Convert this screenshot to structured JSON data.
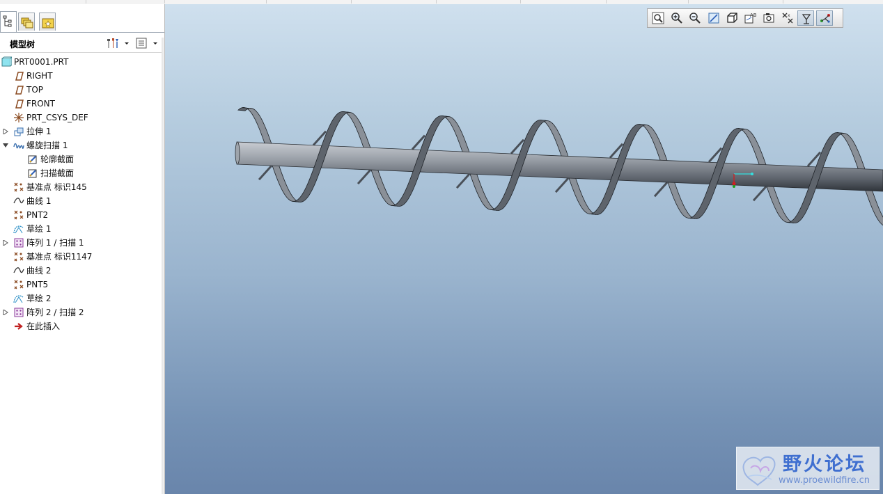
{
  "panel": {
    "title": "模型树",
    "tabs": [
      {
        "name": "model-tree-tab",
        "icon": "tree-icon",
        "active": true
      },
      {
        "name": "folder-browser-tab",
        "icon": "folders-icon",
        "active": false
      },
      {
        "name": "favorites-tab",
        "icon": "favorites-icon",
        "active": false
      }
    ],
    "header_buttons": [
      "settings-icon",
      "show-icon"
    ]
  },
  "tree": [
    {
      "label": "PRT0001.PRT",
      "icon": "part-icon",
      "level": 0,
      "expander": ""
    },
    {
      "label": "RIGHT",
      "icon": "datum-plane-icon",
      "level": 1,
      "expander": ""
    },
    {
      "label": "TOP",
      "icon": "datum-plane-icon",
      "level": 1,
      "expander": ""
    },
    {
      "label": "FRONT",
      "icon": "datum-plane-icon",
      "level": 1,
      "expander": ""
    },
    {
      "label": "PRT_CSYS_DEF",
      "icon": "coordinate-system-icon",
      "level": 1,
      "expander": ""
    },
    {
      "label": "拉伸 1",
      "icon": "extrude-icon",
      "level": 1,
      "expander": "collapsed"
    },
    {
      "label": "螺旋扫描 1",
      "icon": "helical-sweep-icon",
      "level": 1,
      "expander": "expanded"
    },
    {
      "label": "轮廓截面",
      "icon": "sketch-section-icon",
      "level": 2,
      "expander": ""
    },
    {
      "label": "扫描截面",
      "icon": "sketch-section-icon",
      "level": 2,
      "expander": ""
    },
    {
      "label": "基准点 标识145",
      "icon": "datum-point-icon",
      "level": 1,
      "expander": ""
    },
    {
      "label": "曲线 1",
      "icon": "curve-icon",
      "level": 1,
      "expander": ""
    },
    {
      "label": "PNT2",
      "icon": "datum-point-icon",
      "level": 1,
      "expander": ""
    },
    {
      "label": "草绘 1",
      "icon": "sketch-icon",
      "level": 1,
      "expander": ""
    },
    {
      "label": "阵列 1 / 扫描 1",
      "icon": "pattern-icon",
      "level": 1,
      "expander": "collapsed"
    },
    {
      "label": "基准点 标识1147",
      "icon": "datum-point-icon",
      "level": 1,
      "expander": ""
    },
    {
      "label": "曲线 2",
      "icon": "curve-icon",
      "level": 1,
      "expander": ""
    },
    {
      "label": "PNT5",
      "icon": "datum-point-icon",
      "level": 1,
      "expander": ""
    },
    {
      "label": "草绘 2",
      "icon": "sketch-icon",
      "level": 1,
      "expander": ""
    },
    {
      "label": "阵列 2 / 扫描 2",
      "icon": "pattern-icon",
      "level": 1,
      "expander": "collapsed"
    },
    {
      "label": "在此插入",
      "icon": "insert-here-arrow-icon",
      "level": 1,
      "expander": ""
    }
  ],
  "view_toolbar": [
    {
      "name": "refit-button",
      "icon": "refit-icon",
      "on": false
    },
    {
      "name": "zoom-in-button",
      "icon": "zoom-in-icon",
      "on": false
    },
    {
      "name": "zoom-out-button",
      "icon": "zoom-out-icon",
      "on": false
    },
    {
      "name": "repaint-button",
      "icon": "repaint-icon",
      "on": false
    },
    {
      "name": "display-style-button",
      "icon": "display-style-icon",
      "on": false
    },
    {
      "name": "saved-views-button",
      "icon": "saved-views-icon",
      "on": false
    },
    {
      "name": "view-manager-button",
      "icon": "view-manager-icon",
      "on": false
    },
    {
      "name": "datum-display-filter-button",
      "icon": "datum-filter-icon",
      "on": false
    },
    {
      "name": "spin-center-button",
      "icon": "spin-center-icon",
      "on": true
    },
    {
      "name": "annotation-display-button",
      "icon": "annotation-display-icon",
      "on": true
    }
  ],
  "watermark": {
    "title": "野火论坛",
    "url": "www.proewildfire.cn"
  },
  "colors": {
    "viewport_top": "#cfe0ee",
    "viewport_bottom": "#6985ab",
    "shaft": "#7d8591",
    "flight": "#5a6068",
    "watermark_text": "#3f6fd0"
  }
}
